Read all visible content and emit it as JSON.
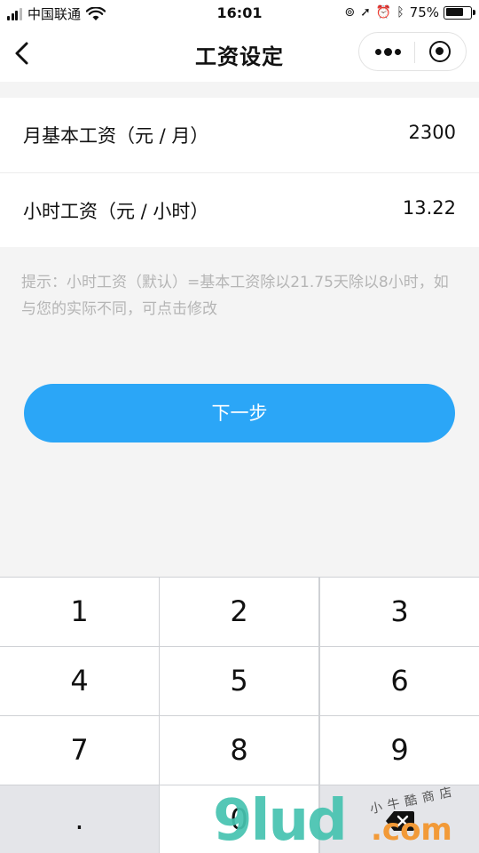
{
  "status_bar": {
    "carrier": "中国联通",
    "time": "16:01",
    "battery_percent": "75%",
    "battery_level": 0.75
  },
  "nav": {
    "title": "工资设定"
  },
  "form": {
    "monthly_label": "月基本工资（元 / 月）",
    "monthly_value": "2300",
    "hourly_label": "小时工资（元 / 小时）",
    "hourly_value": "13.22"
  },
  "hint": "提示：小时工资（默认）=基本工资除以21.75天除以8小时，如与您的实际不同，可点击修改",
  "next_button": "下一步",
  "keypad": {
    "keys": [
      "1",
      "2",
      "3",
      "4",
      "5",
      "6",
      "7",
      "8",
      "9",
      ".",
      "0",
      ""
    ]
  },
  "watermark": {
    "main": "9lud",
    "suffix": ".com",
    "small": "小牛酷商店"
  },
  "colors": {
    "accent": "#2ba6f7",
    "hint": "#b5b5b5",
    "background": "#f4f4f4"
  }
}
